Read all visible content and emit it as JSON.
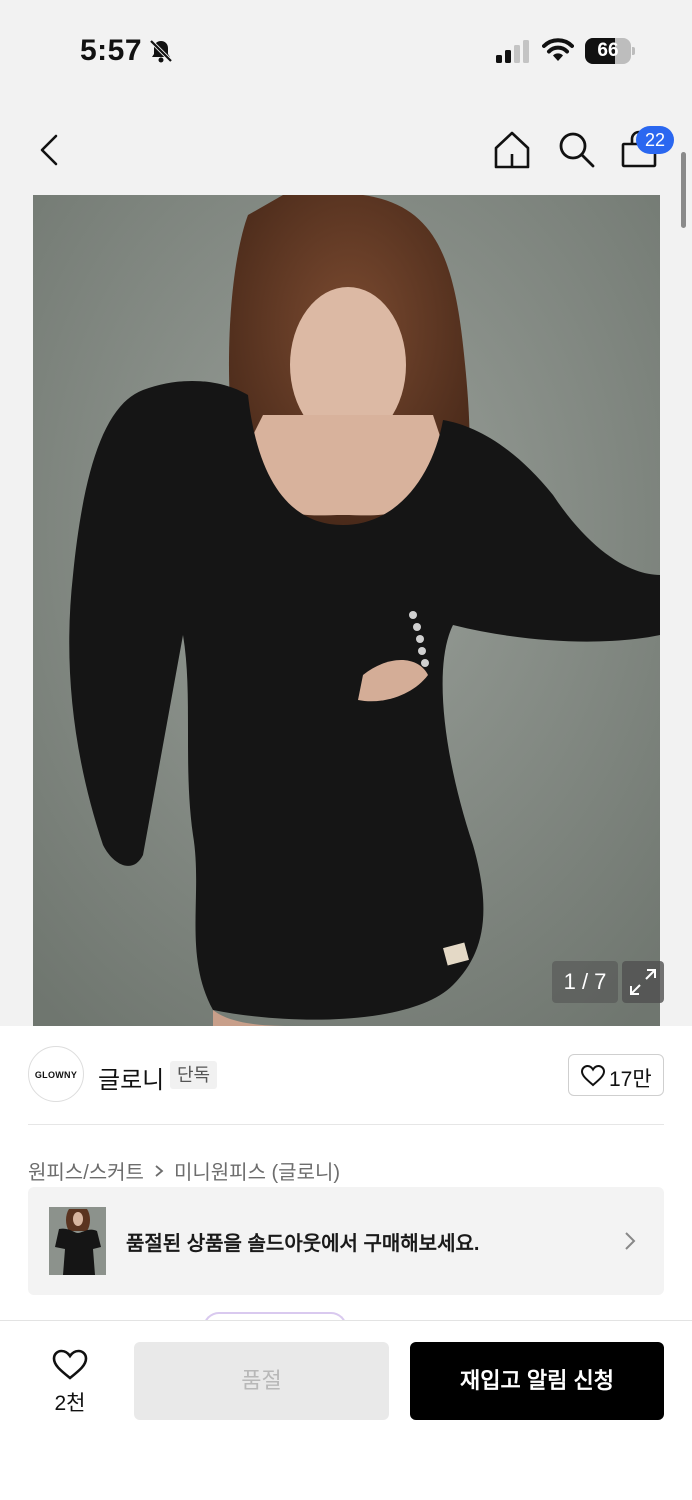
{
  "status_bar": {
    "time": "5:57",
    "battery": "66",
    "battery_level_percent": 66
  },
  "nav": {
    "cart_badge": "22",
    "icons": [
      "chevron-left-icon",
      "home-icon",
      "search-icon",
      "shopping-bag-icon"
    ]
  },
  "gallery": {
    "page_indicator": "1 / 7",
    "current_page": 1,
    "total_pages": 7
  },
  "brand": {
    "logo_text": "GLOWNY",
    "name": "글로니",
    "badge": "단독",
    "like_count": "17만"
  },
  "breadcrumb": {
    "category": "원피스/스커트",
    "subcategory": "미니원피스 (글로니)"
  },
  "soldout_banner": {
    "text": "품절된 상품을 솔드아웃에서 구매해보세요."
  },
  "bottom_bar": {
    "wish_count": "2천",
    "soldout_label": "품절",
    "restock_label": "재입고 알림 신청"
  },
  "colors": {
    "accent_blue": "#2a67f0",
    "primary_black": "#000000",
    "disabled_gray": "#e9e9e9"
  }
}
